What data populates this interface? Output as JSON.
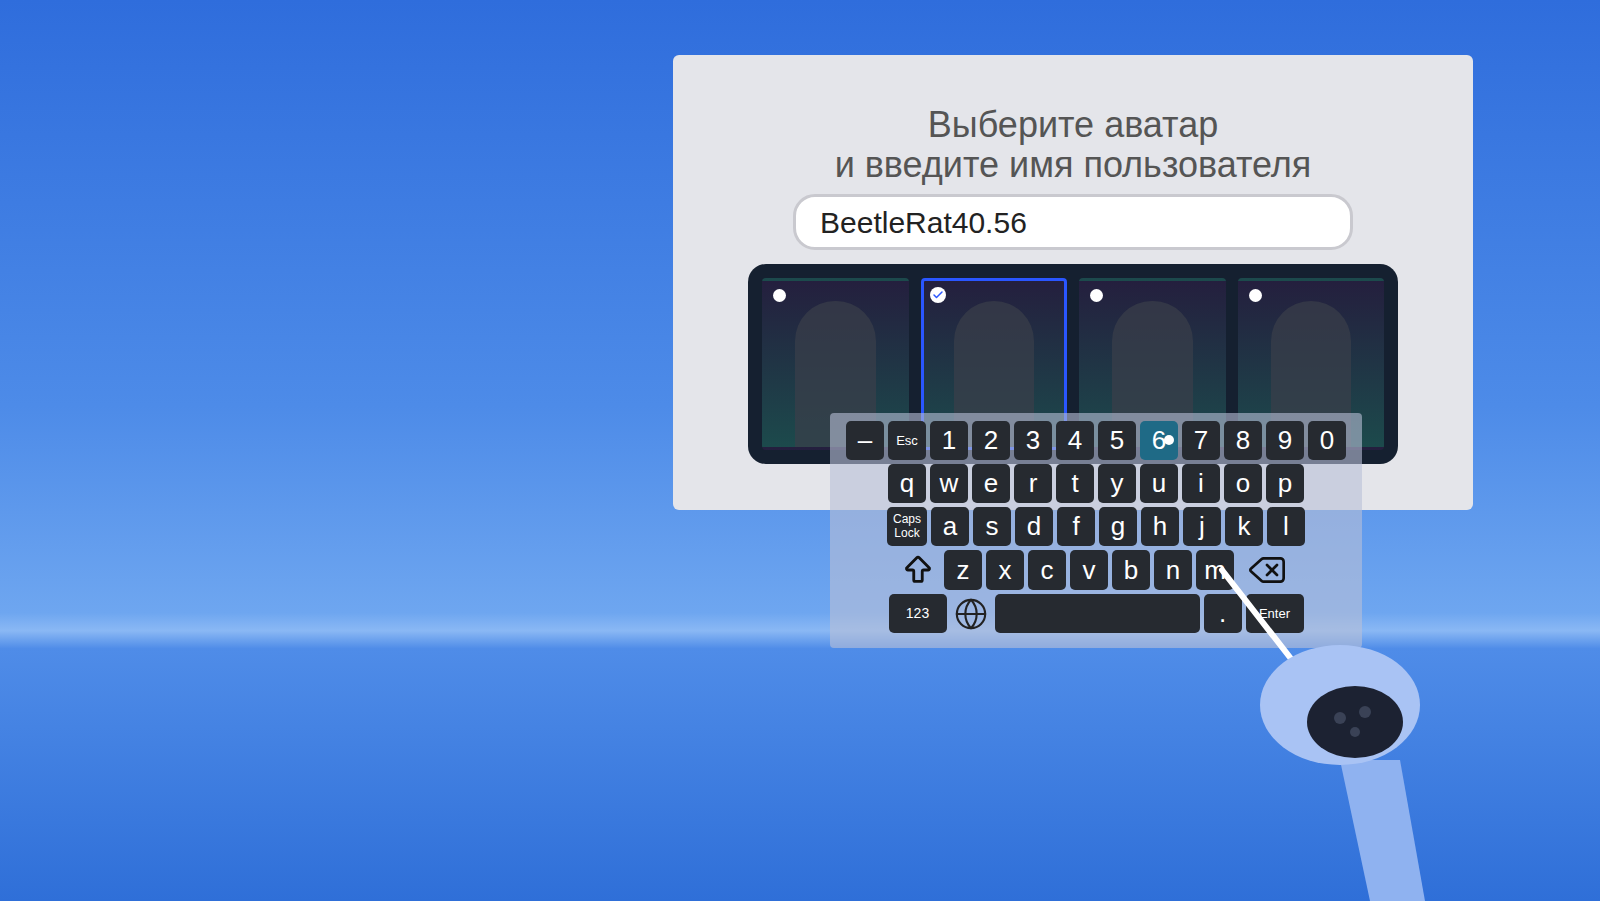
{
  "panel": {
    "title_lines": [
      "Выберите аватар",
      "и введите имя пользователя"
    ]
  },
  "username_field": {
    "value": "BeetleRat40.56"
  },
  "avatars": [
    {
      "selected": false
    },
    {
      "selected": true
    },
    {
      "selected": false
    },
    {
      "selected": false
    }
  ],
  "keyboard": {
    "rows": [
      [
        {
          "kind": "key",
          "label": "–",
          "hovered": false
        },
        {
          "kind": "small",
          "label": "Esc",
          "hovered": false
        },
        {
          "kind": "key",
          "label": "1",
          "hovered": false
        },
        {
          "kind": "key",
          "label": "2",
          "hovered": false
        },
        {
          "kind": "key",
          "label": "3",
          "hovered": false
        },
        {
          "kind": "key",
          "label": "4",
          "hovered": false
        },
        {
          "kind": "key",
          "label": "5",
          "hovered": false
        },
        {
          "kind": "key",
          "label": "6",
          "hovered": true
        },
        {
          "kind": "key",
          "label": "7",
          "hovered": false
        },
        {
          "kind": "key",
          "label": "8",
          "hovered": false
        },
        {
          "kind": "key",
          "label": "9",
          "hovered": false
        },
        {
          "kind": "key",
          "label": "0",
          "hovered": false
        }
      ],
      [
        {
          "kind": "key",
          "label": "q",
          "hovered": false
        },
        {
          "kind": "key",
          "label": "w",
          "hovered": false
        },
        {
          "kind": "key",
          "label": "e",
          "hovered": false
        },
        {
          "kind": "key",
          "label": "r",
          "hovered": false
        },
        {
          "kind": "key",
          "label": "t",
          "hovered": false
        },
        {
          "kind": "key",
          "label": "y",
          "hovered": false
        },
        {
          "kind": "key",
          "label": "u",
          "hovered": false
        },
        {
          "kind": "key",
          "label": "i",
          "hovered": false
        },
        {
          "kind": "key",
          "label": "o",
          "hovered": false
        },
        {
          "kind": "key",
          "label": "p",
          "hovered": false
        }
      ],
      [
        {
          "kind": "caps",
          "label": "Caps Lock",
          "hovered": false
        },
        {
          "kind": "key",
          "label": "a",
          "hovered": false
        },
        {
          "kind": "key",
          "label": "s",
          "hovered": false
        },
        {
          "kind": "key",
          "label": "d",
          "hovered": false
        },
        {
          "kind": "key",
          "label": "f",
          "hovered": false
        },
        {
          "kind": "key",
          "label": "g",
          "hovered": false
        },
        {
          "kind": "key",
          "label": "h",
          "hovered": false
        },
        {
          "kind": "key",
          "label": "j",
          "hovered": false
        },
        {
          "kind": "key",
          "label": "k",
          "hovered": false
        },
        {
          "kind": "key",
          "label": "l",
          "hovered": false
        }
      ],
      [
        {
          "kind": "shift",
          "hovered": false
        },
        {
          "kind": "key",
          "label": "z",
          "hovered": false
        },
        {
          "kind": "key",
          "label": "x",
          "hovered": false
        },
        {
          "kind": "key",
          "label": "c",
          "hovered": false
        },
        {
          "kind": "key",
          "label": "v",
          "hovered": false
        },
        {
          "kind": "key",
          "label": "b",
          "hovered": false
        },
        {
          "kind": "key",
          "label": "n",
          "hovered": false
        },
        {
          "kind": "key",
          "label": "m",
          "hovered": false
        },
        {
          "kind": "backspace",
          "hovered": false
        }
      ],
      [
        {
          "kind": "num",
          "label": "123",
          "hovered": false
        },
        {
          "kind": "globe",
          "hovered": false
        },
        {
          "kind": "space",
          "hovered": false
        },
        {
          "kind": "key",
          "label": ".",
          "hovered": false
        },
        {
          "kind": "enter",
          "label": "Enter",
          "hovered": false
        }
      ]
    ]
  }
}
